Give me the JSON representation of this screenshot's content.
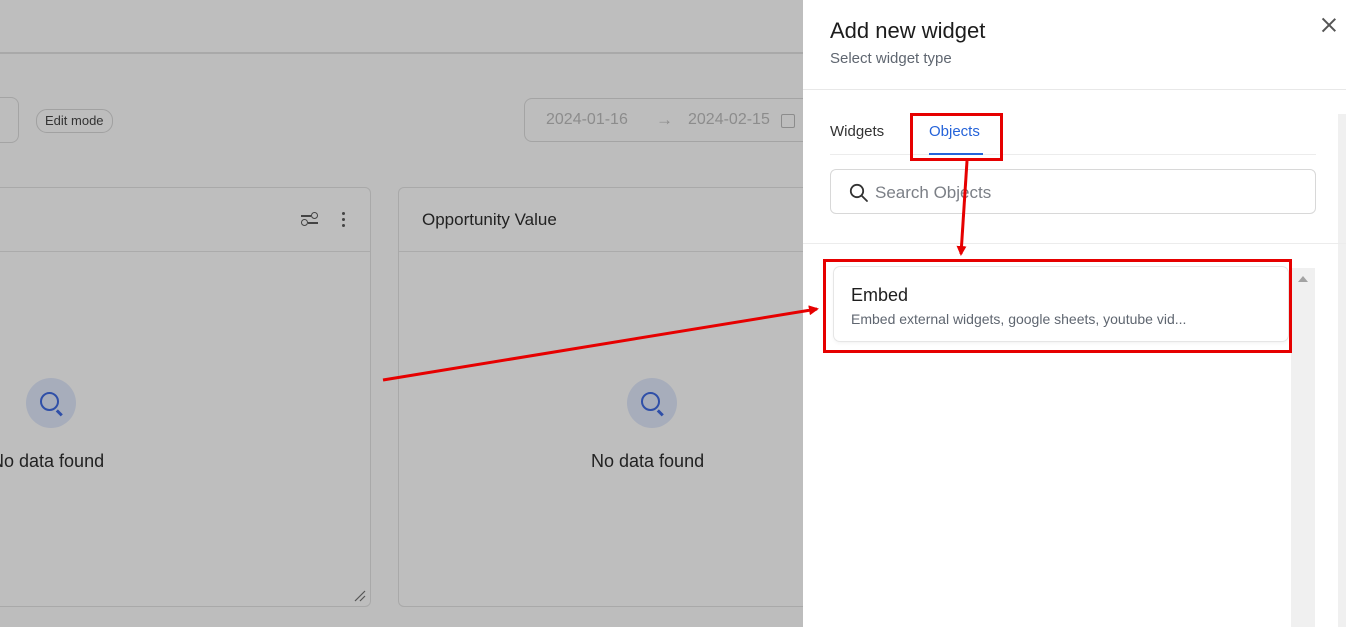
{
  "dashboard": {
    "edit_mode_label": "Edit mode",
    "date_from": "2024-01-16",
    "date_arrow": "→",
    "date_to": "2024-02-15",
    "cards": [
      {
        "title": "",
        "empty_text": "No data found"
      },
      {
        "title": "Opportunity Value",
        "empty_text": "No data found"
      }
    ]
  },
  "panel": {
    "title": "Add new widget",
    "subtitle": "Select widget type",
    "tabs": [
      {
        "label": "Widgets",
        "active": false
      },
      {
        "label": "Objects",
        "active": true
      }
    ],
    "search": {
      "placeholder": "Search Objects",
      "value": ""
    },
    "items": [
      {
        "name": "Embed",
        "description": "Embed external widgets, google sheets, youtube vid..."
      }
    ]
  },
  "annotations": {
    "color": "#e60000"
  },
  "icons": [
    "close-icon",
    "search-icon",
    "filter-icon",
    "kebab-icon",
    "calendar-icon",
    "resize-handle-icon",
    "empty-search-icon"
  ]
}
